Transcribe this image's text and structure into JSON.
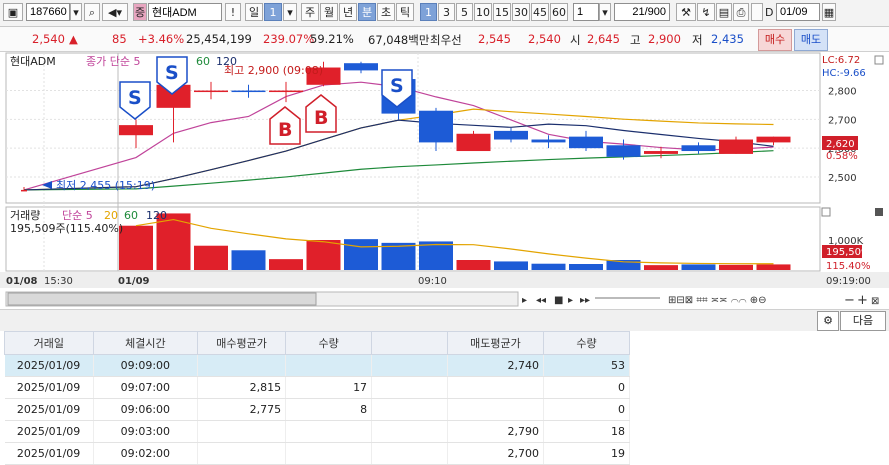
{
  "toolbar": {
    "code": "187660",
    "stock_name": "현대ADM",
    "period_buttons": [
      "일",
      "1",
      "주",
      "월",
      "년",
      "분",
      "초",
      "틱"
    ],
    "minute_buttons": [
      "1",
      "3",
      "5",
      "10",
      "15",
      "30",
      "45",
      "60"
    ],
    "interval_value": "1",
    "count_value": "21/900",
    "date_value": "01/09"
  },
  "quote": {
    "price": "2,540",
    "price_arrow": "▲",
    "change": "85",
    "change_pct": "+3.46%",
    "volume": "25,454,199",
    "vol_ratio": "239.07%",
    "turnover_ratio": "59.21%",
    "amount": "67,048백만",
    "best_ask_label": "최우선",
    "best_ask": "2,545",
    "best_bid": "2,540",
    "open_label": "시",
    "open": "2,645",
    "high_label": "고",
    "high": "2,900",
    "low_label": "저",
    "low": "2,435",
    "buy_button": "매수",
    "sell_button": "매도"
  },
  "price_panel": {
    "title": "현대ADM",
    "ma_legend_label": "종가 단순 5",
    "ma_legend_60": "60",
    "ma_legend_120": "120",
    "lc_label": "LC:6.72",
    "hc_label": "HC:-9.66",
    "high_note": "최고 2,900 (09:08)",
    "low_note": "최저 2,455 (15:19)",
    "current_price_tag": "2,620",
    "current_pct_tag": "0.58%",
    "signal_sell": "S",
    "signal_buy": "B"
  },
  "volume_panel": {
    "title": "거래량",
    "ma_label": "단순 5",
    "ma_20": "20",
    "ma_60": "60",
    "ma_120": "120",
    "current_value": "195,509주(115.40%)",
    "volume_tag": "195,509",
    "volume_pct_tag": "115.40%",
    "axis_1000k": "1,000K"
  },
  "time_axis": {
    "date1": "01/08",
    "time1": "15:30",
    "date2": "01/09",
    "mid": "09:10",
    "right": "09:19:00"
  },
  "controls": {
    "next_button": "다음"
  },
  "chart_data": {
    "type": "candlestick",
    "y_ticks": [
      2500,
      2600,
      2700,
      2800
    ],
    "ylim": [
      2420,
      2920
    ],
    "candles": [
      {
        "time": "01/08 15:19",
        "o": 2455,
        "h": 2465,
        "l": 2455,
        "c": 2455
      },
      {
        "time": "09:00",
        "o": 2645,
        "h": 2700,
        "l": 2600,
        "c": 2680
      },
      {
        "time": "09:01",
        "o": 2740,
        "h": 2830,
        "l": 2620,
        "c": 2820
      },
      {
        "time": "09:02",
        "o": 2800,
        "h": 2830,
        "l": 2770,
        "c": 2800
      },
      {
        "time": "09:03",
        "o": 2800,
        "h": 2820,
        "l": 2775,
        "c": 2795
      },
      {
        "time": "09:04",
        "o": 2795,
        "h": 2830,
        "l": 2760,
        "c": 2800
      },
      {
        "time": "09:05",
        "o": 2820,
        "h": 2900,
        "l": 2815,
        "c": 2880
      },
      {
        "time": "09:06",
        "o": 2895,
        "h": 2900,
        "l": 2860,
        "c": 2870
      },
      {
        "time": "09:07",
        "o": 2840,
        "h": 2860,
        "l": 2700,
        "c": 2720
      },
      {
        "time": "09:08",
        "o": 2730,
        "h": 2740,
        "l": 2590,
        "c": 2620
      },
      {
        "time": "09:10",
        "o": 2590,
        "h": 2660,
        "l": 2590,
        "c": 2650
      },
      {
        "time": "09:11",
        "o": 2660,
        "h": 2670,
        "l": 2620,
        "c": 2630
      },
      {
        "time": "09:12",
        "o": 2630,
        "h": 2645,
        "l": 2600,
        "c": 2620
      },
      {
        "time": "09:13",
        "o": 2640,
        "h": 2660,
        "l": 2590,
        "c": 2600
      },
      {
        "time": "09:14",
        "o": 2610,
        "h": 2630,
        "l": 2560,
        "c": 2570
      },
      {
        "time": "09:15",
        "o": 2580,
        "h": 2605,
        "l": 2565,
        "c": 2590
      },
      {
        "time": "09:16",
        "o": 2610,
        "h": 2620,
        "l": 2580,
        "c": 2590
      },
      {
        "time": "09:17",
        "o": 2580,
        "h": 2640,
        "l": 2580,
        "c": 2630
      },
      {
        "time": "09:18",
        "o": 2620,
        "h": 2640,
        "l": 2610,
        "c": 2640
      }
    ],
    "volumes": [
      1550000,
      1980000,
      850000,
      690000,
      380000,
      1050000,
      1080000,
      950000,
      1000000,
      350000,
      300000,
      220000,
      210000,
      350000,
      170000,
      195509,
      180000,
      195509
    ],
    "colors": {
      "up": "#e0202a",
      "down": "#1d5bd6",
      "ma5": "#c0449a",
      "ma20": "#e3a400",
      "ma60": "#1e8a3a",
      "ma120": "#1b2f6d",
      "vol_ma": "#e3a400"
    }
  },
  "trades": {
    "headers": [
      "거래일",
      "체결시간",
      "매수평균가",
      "수량",
      "",
      "매도평균가",
      "수량"
    ],
    "rows": [
      {
        "date": "2025/01/09",
        "time": "09:09:00",
        "buy_avg": "",
        "buy_qty": "",
        "blank": "",
        "sell_avg": "2,740",
        "sell_qty": "53"
      },
      {
        "date": "2025/01/09",
        "time": "09:07:00",
        "buy_avg": "2,815",
        "buy_qty": "17",
        "blank": "",
        "sell_avg": "",
        "sell_qty": "0"
      },
      {
        "date": "2025/01/09",
        "time": "09:06:00",
        "buy_avg": "2,775",
        "buy_qty": "8",
        "blank": "",
        "sell_avg": "",
        "sell_qty": "0"
      },
      {
        "date": "2025/01/09",
        "time": "09:03:00",
        "buy_avg": "",
        "buy_qty": "",
        "blank": "",
        "sell_avg": "2,790",
        "sell_qty": "18"
      },
      {
        "date": "2025/01/09",
        "time": "09:02:00",
        "buy_avg": "",
        "buy_qty": "",
        "blank": "",
        "sell_avg": "2,700",
        "sell_qty": "19"
      }
    ]
  }
}
